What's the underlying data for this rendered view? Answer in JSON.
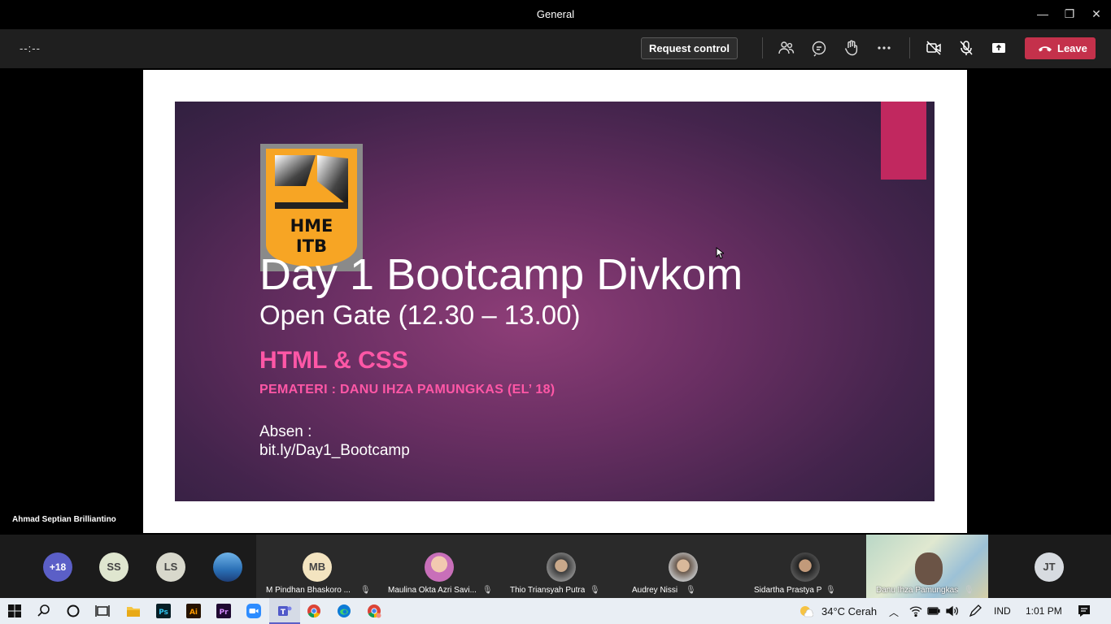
{
  "window": {
    "title": "General",
    "minimize_label": "—",
    "restore_label": "❐",
    "close_label": "✕"
  },
  "toolbar": {
    "timer": "--:--",
    "request_control_label": "Request control",
    "icons": [
      "people-icon",
      "chat-icon",
      "raise-hand-icon",
      "more-options-icon",
      "camera-off-icon",
      "mic-off-icon",
      "share-screen-icon"
    ],
    "leave_label": "Leave",
    "leave_color": "#c4314b"
  },
  "slide": {
    "title": "Day 1 Bootcamp Divkom",
    "subtitle": "Open Gate (12.30 – 13.00)",
    "topic": "HTML & CSS",
    "speaker": "PEMATERI : DANU IHZA PAMUNGKAS (EL’ 18)",
    "absen_label": "Absen :",
    "absen_link": "bit.ly/Day1_Bootcamp",
    "logo_text_1": "HME",
    "logo_text_2": "ITB",
    "accent_color": "#c1285f",
    "highlight_color": "#ff57a6"
  },
  "presenter": {
    "name": "Ahmad Septian Brilliantino"
  },
  "participants": {
    "overflow": "+18",
    "small_avatars": [
      "SS",
      "LS"
    ],
    "tiles": [
      {
        "initials": "MB",
        "name": "M Pindhan Bhaskoro ..."
      },
      {
        "initials": "",
        "name": "Maulina Okta Azri Savi..."
      },
      {
        "initials": "",
        "name": "Thio Triansyah Putra"
      },
      {
        "initials": "",
        "name": "Audrey Nissi"
      },
      {
        "initials": "",
        "name": "Sidartha Prastya P"
      },
      {
        "initials": "",
        "name": "Danu Ihza Pamungkas"
      }
    ],
    "last_avatar": "JT"
  },
  "taskbar": {
    "apps": [
      "start-icon",
      "search-icon",
      "cortana-icon",
      "task-view-icon",
      "file-explorer-icon",
      "photoshop-icon",
      "illustrator-icon",
      "premiere-icon",
      "zoom-icon",
      "teams-icon",
      "chrome-icon",
      "edge-icon",
      "chrome-profile-icon"
    ],
    "weather": "34°C  Cerah",
    "language": "IND",
    "time": "1:01 PM"
  }
}
